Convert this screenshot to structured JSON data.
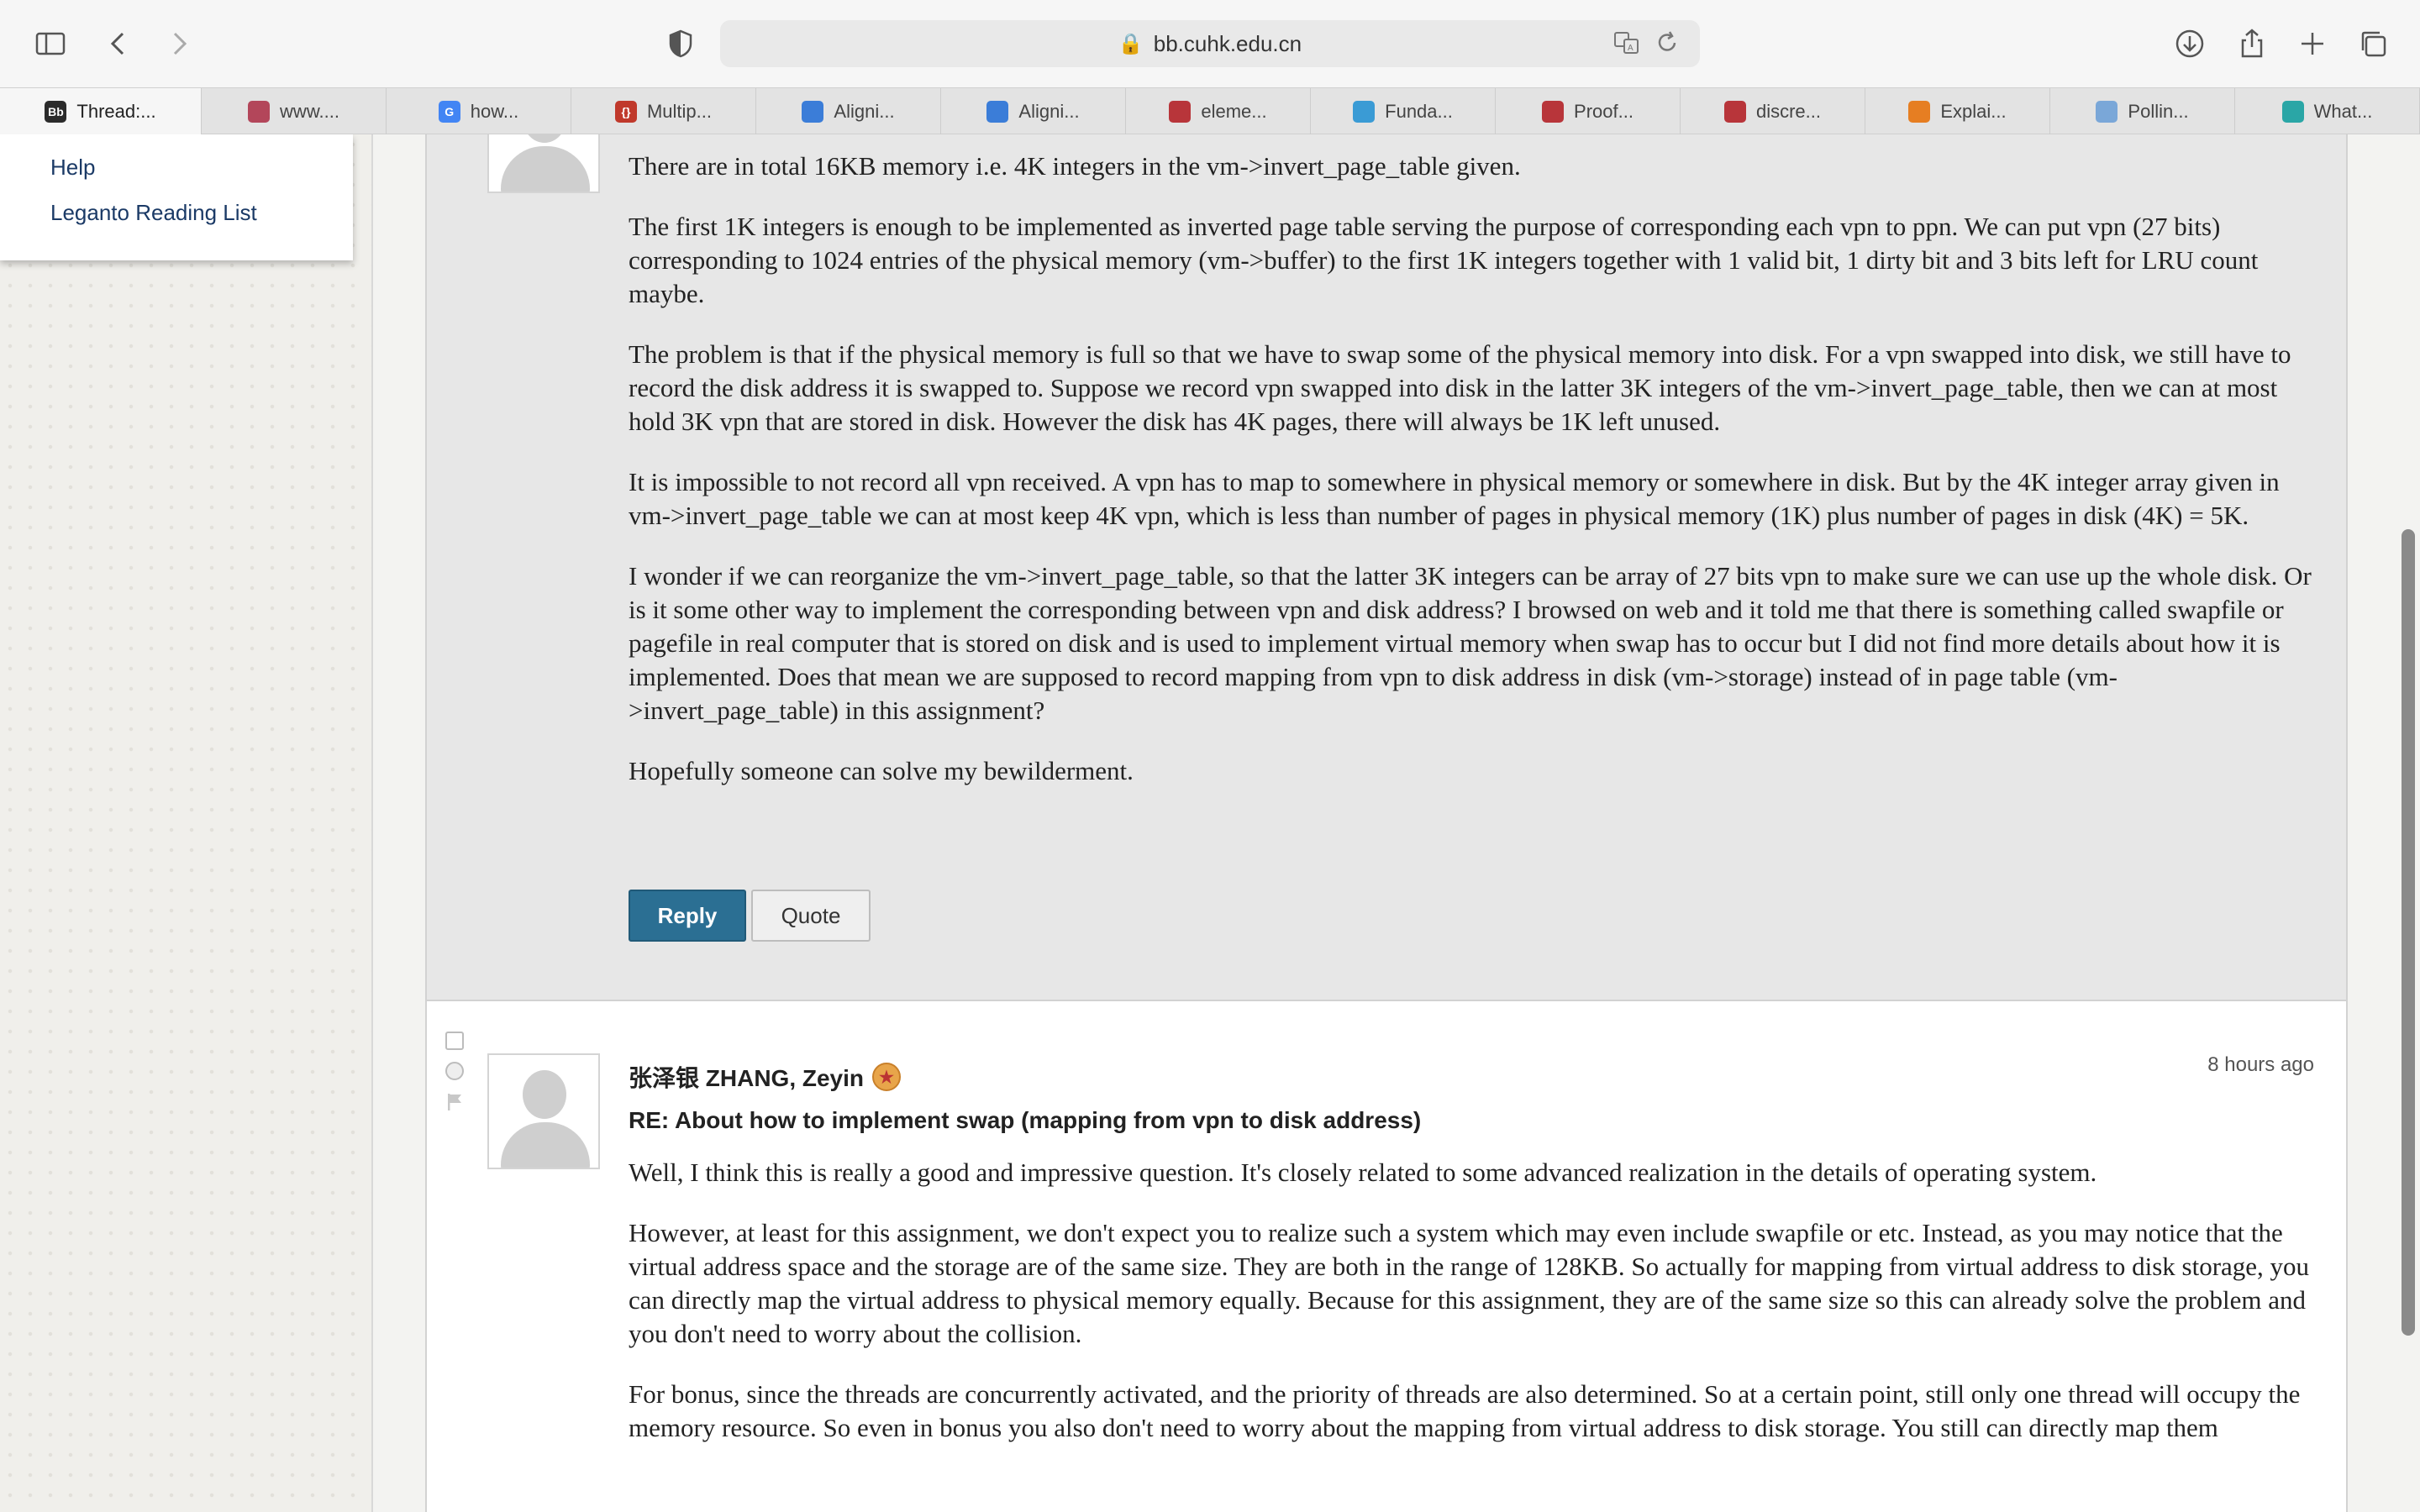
{
  "browser": {
    "url": "bb.cuhk.edu.cn",
    "tabs": [
      {
        "label": "Thread:...",
        "icon": "Bb",
        "color": "#2b2b2b",
        "active": true
      },
      {
        "label": "www....",
        "icon": "",
        "color": "#b3465a",
        "active": false
      },
      {
        "label": "how...",
        "icon": "G",
        "color": "#4285f4",
        "active": false
      },
      {
        "label": "Multip...",
        "icon": "{}",
        "color": "#c0392b",
        "active": false
      },
      {
        "label": "Aligni...",
        "icon": "",
        "color": "#3b7dd8",
        "active": false
      },
      {
        "label": "Aligni...",
        "icon": "",
        "color": "#3b7dd8",
        "active": false
      },
      {
        "label": "eleme...",
        "icon": "",
        "color": "#b8353a",
        "active": false
      },
      {
        "label": "Funda...",
        "icon": "",
        "color": "#3a9bd5",
        "active": false
      },
      {
        "label": "Proof...",
        "icon": "",
        "color": "#b8353a",
        "active": false
      },
      {
        "label": "discre...",
        "icon": "",
        "color": "#b8353a",
        "active": false
      },
      {
        "label": "Explai...",
        "icon": "",
        "color": "#e67e22",
        "active": false
      },
      {
        "label": "Pollin...",
        "icon": "",
        "color": "#7aa7d8",
        "active": false
      },
      {
        "label": "What...",
        "icon": "",
        "color": "#2aa6a6",
        "active": false
      }
    ]
  },
  "sidebar_menu": {
    "items": [
      "Help",
      "Leganto Reading List"
    ]
  },
  "post1": {
    "paragraphs": [
      "There are in total 16KB memory i.e. 4K integers in the vm->invert_page_table given.",
      "The first 1K integers is enough to be implemented as inverted page table serving the purpose of corresponding each vpn to ppn. We can put vpn (27 bits) corresponding to 1024 entries of the physical memory (vm->buffer) to the first 1K integers together with 1 valid bit, 1 dirty bit and 3 bits left for LRU count maybe.",
      "The problem is that if the physical memory is full so that we have to swap some of the physical memory into disk. For a vpn swapped into disk, we still have to record the disk address it is swapped to. Suppose we record vpn swapped into disk in the latter 3K integers of the vm->invert_page_table, then we can at most hold 3K vpn that are stored in disk. However the disk has 4K pages, there will always be 1K left unused.",
      "It is impossible to not record all vpn received. A vpn has to map to somewhere in physical memory or somewhere in disk. But by the 4K integer array given in vm->invert_page_table we can at most keep 4K vpn, which is less than number of pages in physical memory (1K) plus number of pages in disk (4K) = 5K.",
      "I wonder if we can reorganize the vm->invert_page_table, so that the latter 3K integers can be array of 27 bits vpn to make sure we can use up the whole disk. Or is it some other way to implement the corresponding between vpn and disk address? I browsed on web and it told me that there is something called swapfile or pagefile in real computer that is stored on disk and is used to implement virtual memory when swap has to occur but I did not find more details about how it is implemented. Does that mean we are supposed to record mapping from vpn to disk address in disk (vm->storage) instead of in page table (vm->invert_page_table) in this assignment?",
      "Hopefully someone can solve my bewilderment."
    ],
    "reply_label": "Reply",
    "quote_label": "Quote"
  },
  "post2": {
    "author": "张泽银 ZHANG, Zeyin",
    "timestamp": "8 hours ago",
    "subject": "RE: About how to implement swap (mapping from vpn to disk address)",
    "paragraphs": [
      "Well, I think this is really a good and impressive question. It's closely related to some advanced realization in the details of operating system.",
      "However, at least for this assignment, we don't expect you to realize such a system which may even include swapfile or etc. Instead, as you may notice that the virtual address space and the storage are of the same size. They are both in the range of 128KB. So actually for mapping from virtual address to disk storage, you can directly map the virtual address to physical memory equally. Because for this assignment, they are of the same size so this can already solve the problem and you don't need to worry about the collision.",
      "For bonus, since the threads are concurrently activated, and the priority of threads are also determined. So at a certain point, still only one thread will occupy the memory resource. So even in bonus you also don't need to worry about the mapping from virtual address to disk storage. You still can directly map them"
    ]
  }
}
